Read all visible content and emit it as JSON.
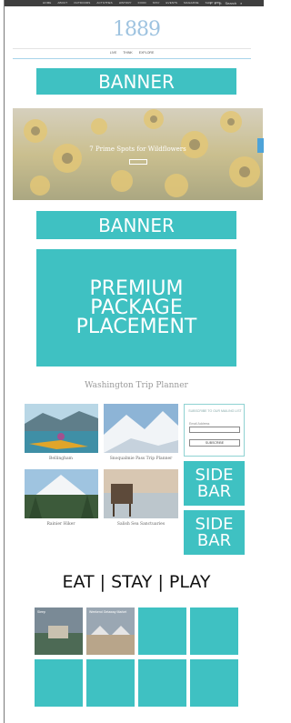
{
  "top_nav": {
    "items": [
      "HOME",
      "ABOUT",
      "OUTDOORS",
      "ACTIVITIES",
      "HISTORY",
      "FOOD",
      "STAY",
      "EVENTS",
      "MAGAZINE",
      "SHOP 1889"
    ],
    "social_icons": [
      "facebook-icon",
      "twitter-icon",
      "pinterest-icon"
    ],
    "search_label": "Search"
  },
  "logo": {
    "text": "1889"
  },
  "sub_nav": {
    "items": [
      "LIVE",
      "THINK",
      "EXPLORE"
    ]
  },
  "banner_top": {
    "label": "BANNER"
  },
  "hero": {
    "title": "7 Prime Spots for Wildflowers"
  },
  "banner_mid": {
    "label": "BANNER"
  },
  "premium": {
    "label": "PREMIUM\nPACKAGE\nPLACEMENT"
  },
  "trip_planner": {
    "title": "Washington Trip Planner",
    "cards": [
      {
        "caption": "Bellingham"
      },
      {
        "caption": "Snoqualmie Pass Trip Planner"
      },
      {
        "caption": "Rainier Hiker"
      },
      {
        "caption": "Salish Sea Sanctuaries"
      }
    ]
  },
  "subscribe": {
    "heading": "SUBSCRIBE TO OUR MAILING LIST",
    "email_label": "Email Address",
    "button_label": "SUBSCRIBE"
  },
  "sidebar_ads": [
    {
      "label": "SIDE\nBAR"
    },
    {
      "label": "SIDE\nBAR"
    }
  ],
  "eat_stay_play": {
    "title": "EAT | STAY | PLAY",
    "tiles": [
      {
        "label": "Sleep"
      },
      {
        "label": "Weekend Getaway Market"
      }
    ]
  },
  "colors": {
    "accent": "#3fc1c2",
    "topbar": "#3f3f3f",
    "logo": "#9ec3e0"
  }
}
